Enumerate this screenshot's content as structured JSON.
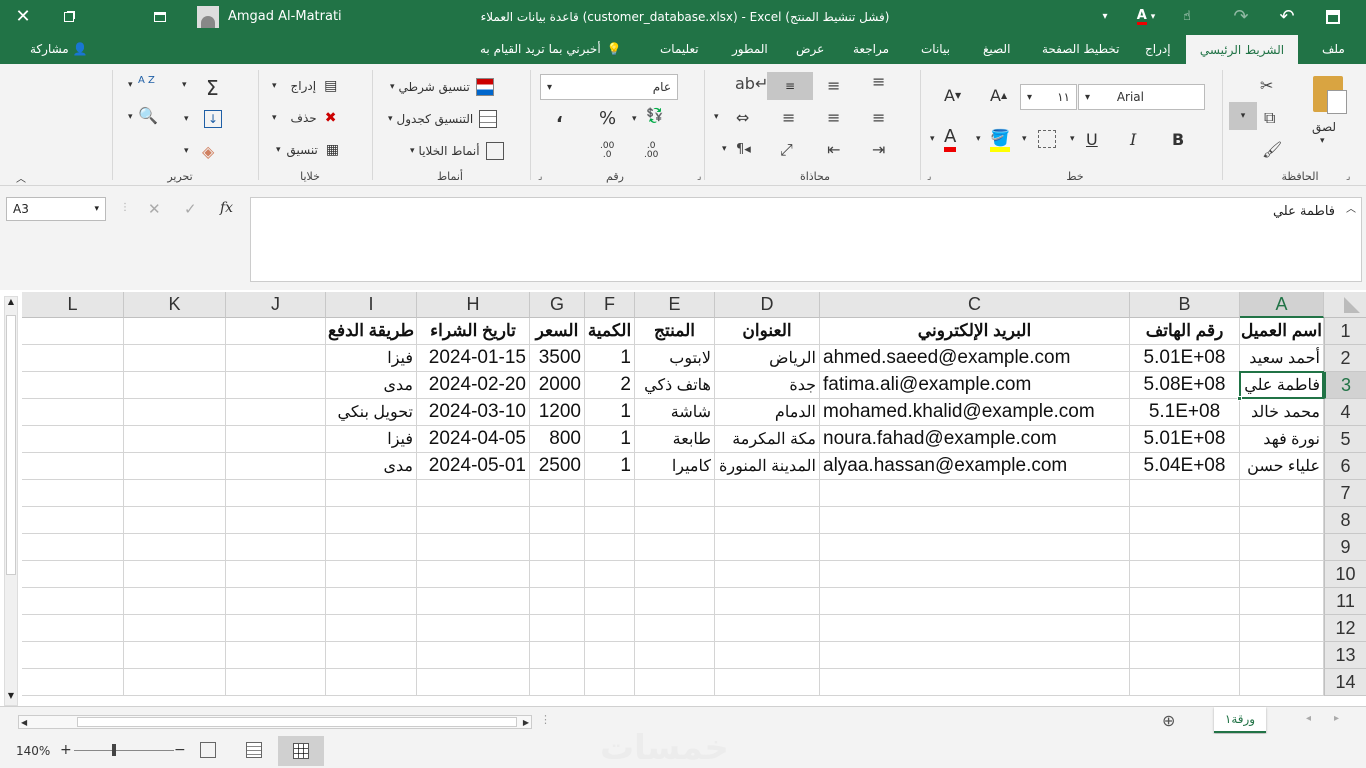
{
  "window": {
    "title": "قاعدة بيانات العملاء (customer_database.xlsx)  -  Excel  (فشل تنشيط المنتج)",
    "user": "Amgad Al-Matrati"
  },
  "ribbon_tabs": [
    "ملف",
    "الشريط الرئيسي",
    "إدراج",
    "تخطيط الصفحة",
    "الصيغ",
    "بيانات",
    "مراجعة",
    "عرض",
    "المطور",
    "تعليمات"
  ],
  "tell_me": "أخبرني بما تريد القيام به",
  "share": "مشاركة",
  "ribbon": {
    "clipboard": {
      "label": "الحافظة",
      "paste": "لصق"
    },
    "font": {
      "label": "خط",
      "name": "Arial",
      "size": "١١",
      "bold": "B",
      "italic": "I",
      "underline": "U"
    },
    "alignment": {
      "label": "محاذاة"
    },
    "number": {
      "label": "رقم",
      "format": "عام",
      "percent": "%",
      "comma": "،",
      "inc_decimal": ".0 ←.00",
      "dec_decimal": ".00 →.0"
    },
    "styles": {
      "label": "أنماط",
      "conditional": "تنسيق شرطي",
      "table": "التنسيق كجدول",
      "cell_styles": "أنماط الخلايا"
    },
    "cells": {
      "label": "خلايا",
      "insert": "إدراج",
      "delete": "حذف",
      "format": "تنسيق"
    },
    "editing": {
      "label": "تحرير",
      "sort": "A Z"
    }
  },
  "formula_bar": {
    "name_box": "A3",
    "fx": "fx",
    "value": "فاطمة علي"
  },
  "columns": [
    "A",
    "B",
    "C",
    "D",
    "E",
    "F",
    "G",
    "H",
    "I",
    "J",
    "K",
    "L"
  ],
  "rows": [
    "1",
    "2",
    "3",
    "4",
    "5",
    "6",
    "7",
    "8",
    "9",
    "10",
    "11",
    "12",
    "13",
    "14"
  ],
  "headers": [
    "اسم العميل",
    "رقم الهاتف",
    "البريد الإلكتروني",
    "العنوان",
    "المنتج",
    "الكمية",
    "السعر",
    "تاريخ الشراء",
    "طريقة الدفع"
  ],
  "data": [
    [
      "أحمد سعيد",
      "5.01E+08",
      "ahmed.saeed@example.com",
      "الرياض",
      "لابتوب",
      "1",
      "3500",
      "2024-01-15",
      "فيزا"
    ],
    [
      "فاطمة علي",
      "5.08E+08",
      "fatima.ali@example.com",
      "جدة",
      "هاتف ذكي",
      "2",
      "2000",
      "2024-02-20",
      "مدى"
    ],
    [
      "محمد خالد",
      "5.1E+08",
      "mohamed.khalid@example.com",
      "الدمام",
      "شاشة",
      "1",
      "1200",
      "2024-03-10",
      "تحويل بنكي"
    ],
    [
      "نورة فهد",
      "5.01E+08",
      "noura.fahad@example.com",
      "مكة المكرمة",
      "طابعة",
      "1",
      "800",
      "2024-04-05",
      "فيزا"
    ],
    [
      "علياء حسن",
      "5.04E+08",
      "alyaa.hassan@example.com",
      "المدينة المنورة",
      "كاميرا",
      "1",
      "2500",
      "2024-05-01",
      "مدى"
    ]
  ],
  "sheet_tab": "ورقة١",
  "watermark": "خمسات",
  "status": {
    "zoom": "140%"
  }
}
